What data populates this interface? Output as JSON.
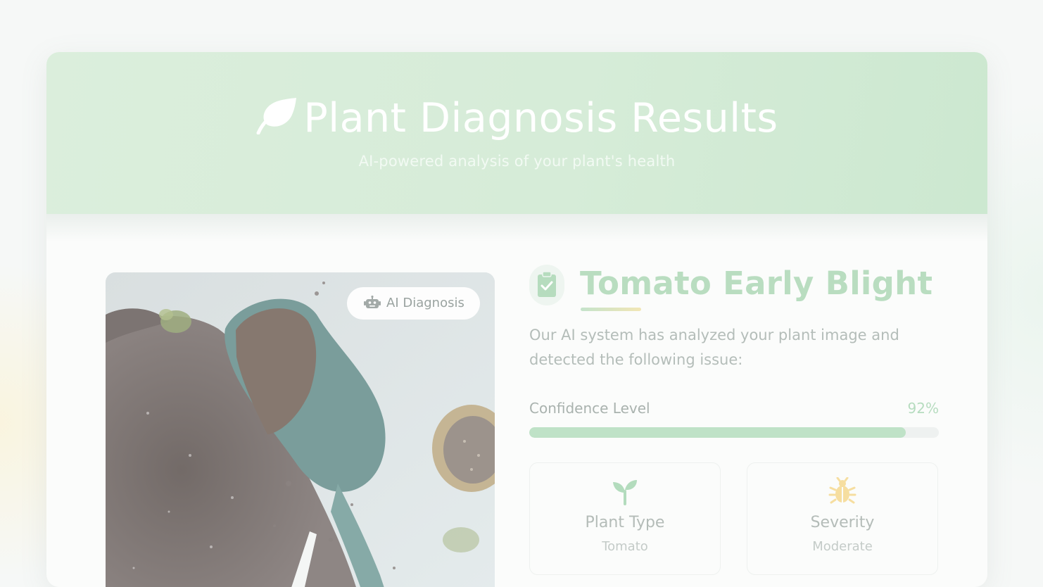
{
  "header": {
    "title": "Plant Diagnosis Results",
    "subtitle": "AI-powered analysis of your plant's health",
    "title_icon": "leaf-icon"
  },
  "photo": {
    "badge_label": "AI Diagnosis",
    "badge_icon": "robot-icon",
    "image_description_icon": "plant-photo"
  },
  "diagnosis": {
    "icon": "clipboard-check-icon",
    "title": "Tomato Early Blight",
    "description": "Our AI system has analyzed your plant image and detected the following issue:"
  },
  "confidence": {
    "label": "Confidence Level",
    "value_text": "92%",
    "value": 0.92
  },
  "info_cards": [
    {
      "icon": "seedling-icon",
      "label": "Plant Type",
      "value": "Tomato"
    },
    {
      "icon": "bug-icon",
      "label": "Severity",
      "value": "Moderate"
    }
  ],
  "colors": {
    "header_green": "#d6ecd8",
    "accent_green": "#b9ddc0",
    "severity_yellow": "#f6dea0"
  }
}
